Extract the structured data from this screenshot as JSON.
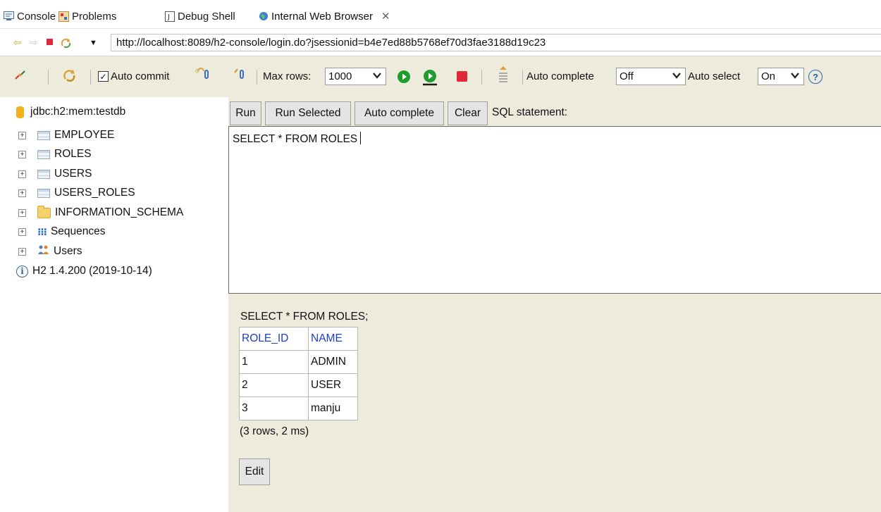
{
  "view_tabs": {
    "console": "Console",
    "problems": "Problems",
    "debug_shell": "Debug Shell",
    "browser": "Internal Web Browser",
    "close_glyph": "✕"
  },
  "address_bar": {
    "url": "http://localhost:8089/h2-console/login.do?jsessionid=b4e7ed88b5768ef70d3fae3188d19c23"
  },
  "toolbar": {
    "auto_commit_label": "Auto commit",
    "auto_commit_checked": true,
    "max_rows_label": "Max rows:",
    "max_rows_value": "1000",
    "auto_complete_label": "Auto complete",
    "auto_complete_value": "Off",
    "auto_select_label": "Auto select",
    "auto_select_value": "On",
    "help_glyph": "?"
  },
  "tree": {
    "connection": "jdbc:h2:mem:testdb",
    "tables": [
      "EMPLOYEE",
      "ROLES",
      "USERS",
      "USERS_ROLES"
    ],
    "schema": "INFORMATION_SCHEMA",
    "sequences": "Sequences",
    "users": "Users",
    "version": "H2 1.4.200 (2019-10-14)"
  },
  "query": {
    "run": "Run",
    "run_selected": "Run Selected",
    "auto_complete": "Auto complete",
    "clear": "Clear",
    "label": "SQL statement:",
    "text": "SELECT * FROM ROLES"
  },
  "result": {
    "query": "SELECT * FROM ROLES;",
    "columns": [
      "ROLE_ID",
      "NAME"
    ],
    "rows": [
      [
        "1",
        "ADMIN"
      ],
      [
        "2",
        "USER"
      ],
      [
        "3",
        "manju"
      ]
    ],
    "summary": "(3 rows, 2 ms)",
    "edit": "Edit"
  },
  "colors": {
    "panel_bg": "#ecebdc",
    "header_link": "#1e3dc7",
    "run_green": "#1e9c2c",
    "stop_red": "#e0283a"
  }
}
